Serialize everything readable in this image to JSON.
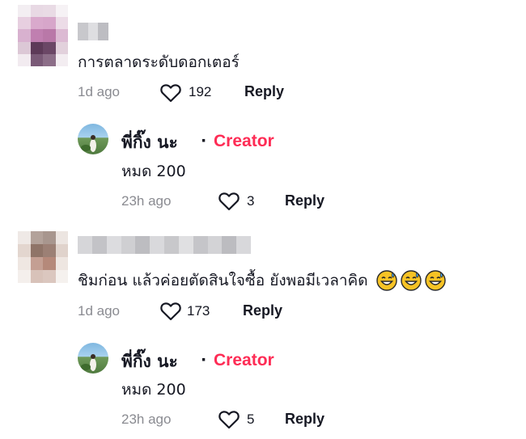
{
  "comments": [
    {
      "text": "การตลาดระดับดอกเตอร์",
      "time": "1d ago",
      "likes": "192",
      "reply_label": "Reply",
      "reply": {
        "author": "พี่กิ๊ง นะ",
        "separator": "·",
        "badge": "Creator",
        "text": "หมด 200",
        "time": "23h ago",
        "likes": "3",
        "reply_label": "Reply"
      }
    },
    {
      "text": "ชิมก่อน แล้วค่อยตัดสินใจซื้อ ยังพอมีเวลาคิด",
      "emojis": [
        "grinning-sweat-emoji",
        "grinning-sweat-emoji",
        "grinning-sweat-emoji"
      ],
      "time": "1d ago",
      "likes": "173",
      "reply_label": "Reply",
      "reply": {
        "author": "พี่กิ๊ง นะ",
        "separator": "·",
        "badge": "Creator",
        "text": "หมด 200",
        "time": "23h ago",
        "likes": "5",
        "reply_label": "Reply"
      }
    }
  ],
  "colors": {
    "creator_badge": "#fe2c55",
    "meta_gray": "#8a8b91",
    "text": "#161823"
  }
}
